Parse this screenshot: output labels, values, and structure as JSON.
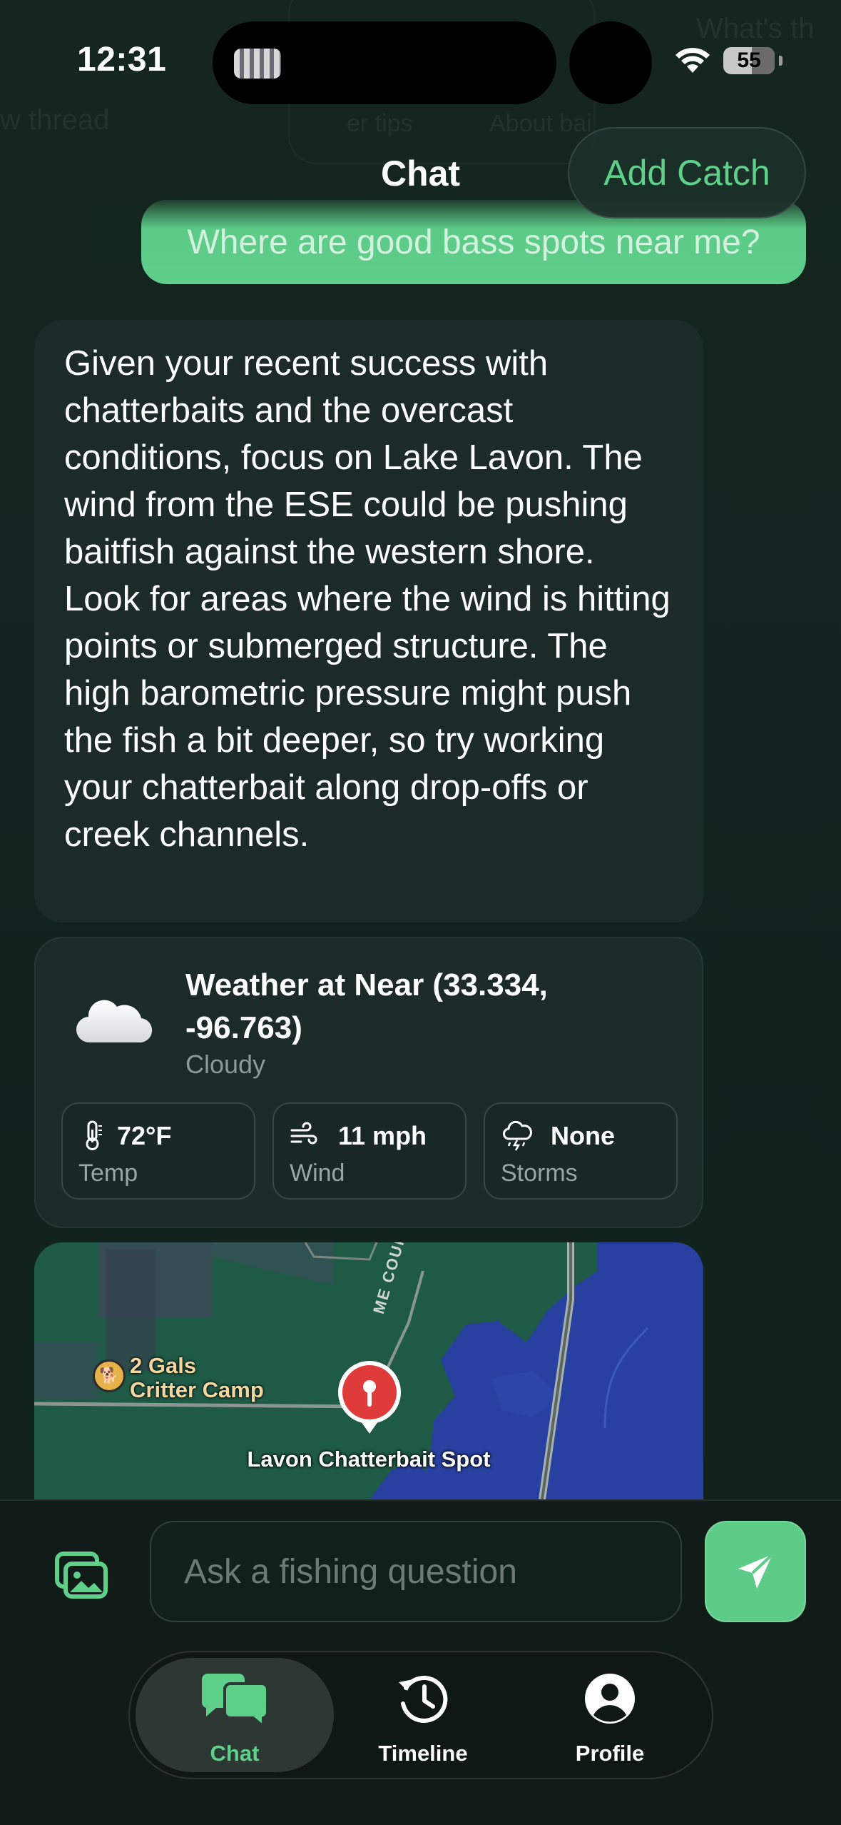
{
  "status_bar": {
    "time": "12:31",
    "battery": "55"
  },
  "nav": {
    "title": "Chat",
    "add_catch_label": "Add Catch"
  },
  "background_ghost": {
    "left_text": "w thread",
    "mid_text_1": "er tips",
    "mid_text_2": "About bai",
    "right_text": "What's th"
  },
  "messages": {
    "user_message": "Where are good bass spots near me?",
    "assistant_message": "Given your recent success with chatterbaits and the overcast conditions, focus on Lake Lavon. The wind from the ESE could be pushing baitfish against the western shore. Look for areas where the wind is hitting points or submerged structure. The high barometric pressure might push the fish a bit deeper, so try working your chatterbait along drop-offs or creek channels."
  },
  "weather": {
    "title": "Weather at Near (33.334, -96.763)",
    "condition": "Cloudy",
    "condition_icon": "cloud-icon",
    "stats": [
      {
        "icon": "thermometer-icon",
        "value": "72°F",
        "label": "Temp"
      },
      {
        "icon": "wind-icon",
        "value": "11 mph",
        "label": "Wind"
      },
      {
        "icon": "storm-icon",
        "value": "None",
        "label": "Storms"
      }
    ]
  },
  "map": {
    "poi_label_line1": "2 Gals",
    "poi_label_line2": "Critter Camp",
    "pin_label": "Lavon Chatterbait Spot",
    "road_label": "ME COUN"
  },
  "composer": {
    "placeholder": "Ask a fishing question",
    "value": ""
  },
  "tabs": [
    {
      "label": "Chat",
      "icon": "chat-bubbles-icon",
      "active": true
    },
    {
      "label": "Timeline",
      "icon": "history-icon",
      "active": false
    },
    {
      "label": "Profile",
      "icon": "profile-icon",
      "active": false
    }
  ],
  "colors": {
    "accent": "#5fd08a",
    "background": "#132420",
    "card": "#1c2b28",
    "pin": "#e03b3b",
    "water": "#2840a0"
  }
}
